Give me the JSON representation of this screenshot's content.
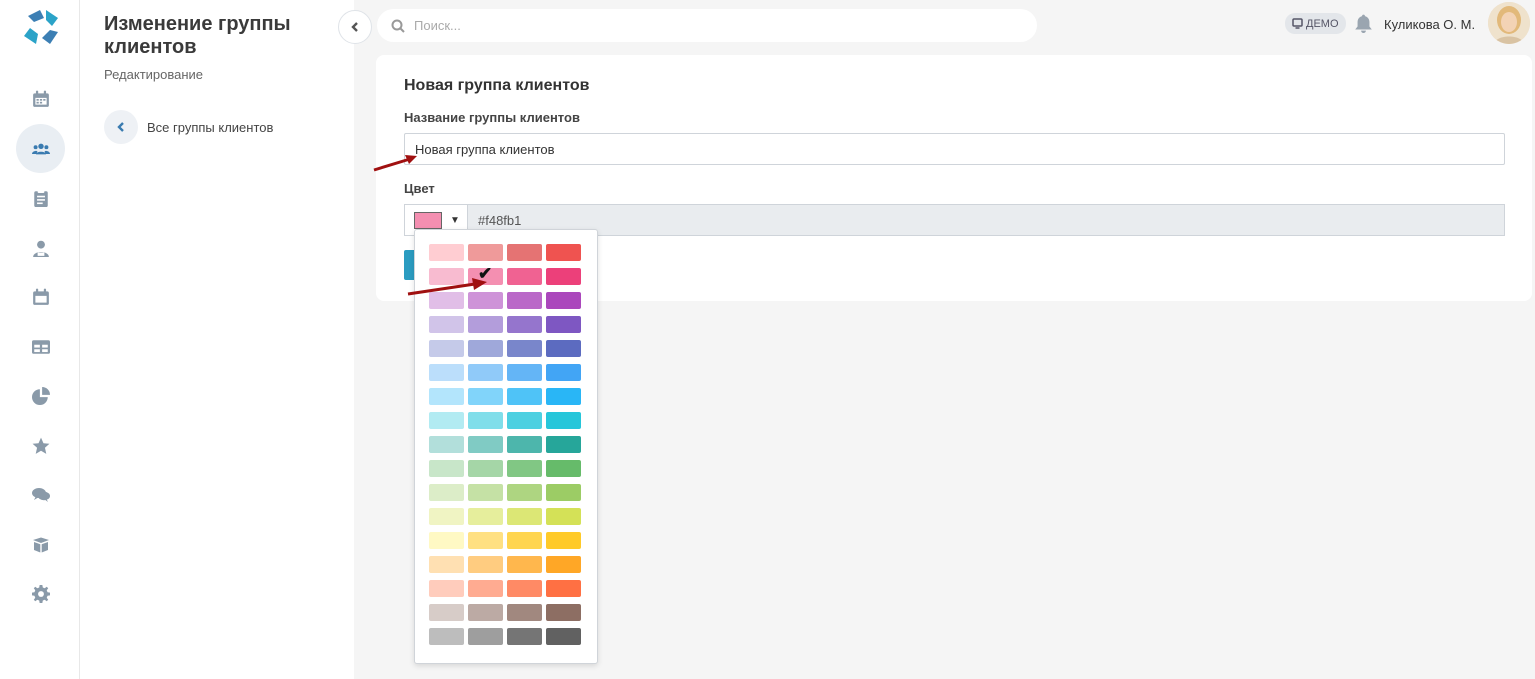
{
  "nav": {
    "items": [
      {
        "name": "calendar-icon",
        "active": false
      },
      {
        "name": "clients-icon",
        "active": true
      },
      {
        "name": "clipboard-icon",
        "active": false
      },
      {
        "name": "staff-icon",
        "active": false
      },
      {
        "name": "schedule-icon",
        "active": false
      },
      {
        "name": "table-icon",
        "active": false
      },
      {
        "name": "chart-pie-icon",
        "active": false
      },
      {
        "name": "star-icon",
        "active": false
      },
      {
        "name": "comments-icon",
        "active": false
      },
      {
        "name": "box-icon",
        "active": false
      },
      {
        "name": "gear-icon",
        "active": false
      }
    ]
  },
  "panel": {
    "title": "Изменение группы клиентов",
    "subtitle": "Редактирование",
    "back_label": "Все группы клиентов"
  },
  "topbar": {
    "search_placeholder": "Поиск...",
    "demo_label": "ДЕМО",
    "user_name": "Куликова О. М."
  },
  "form": {
    "card_title": "Новая группа клиентов",
    "name_label": "Название группы клиентов",
    "name_value": "Новая группа клиентов",
    "color_label": "Цвет",
    "color_value": "#f48fb1",
    "caret": "▼"
  },
  "palette": {
    "selected": "#f48fb1",
    "check_symbol": "✔",
    "rows": [
      [
        "#ffcdd2",
        "#ef9a9a",
        "#e57373",
        "#ef5350"
      ],
      [
        "#f8bbd0",
        "#f48fb1",
        "#f06292",
        "#ec407a"
      ],
      [
        "#e1bee7",
        "#ce93d8",
        "#ba68c8",
        "#ab47bc"
      ],
      [
        "#d1c4e9",
        "#b39ddb",
        "#9575cd",
        "#7e57c2"
      ],
      [
        "#c5cae9",
        "#9fa8da",
        "#7986cb",
        "#5c6bc0"
      ],
      [
        "#bbdefb",
        "#90caf9",
        "#64b5f6",
        "#42a5f5"
      ],
      [
        "#b3e5fc",
        "#81d4fa",
        "#4fc3f7",
        "#29b6f6"
      ],
      [
        "#b2ebf2",
        "#80deea",
        "#4dd0e1",
        "#26c6da"
      ],
      [
        "#b2dfdb",
        "#80cbc4",
        "#4db6ac",
        "#26a69a"
      ],
      [
        "#c8e6c9",
        "#a5d6a7",
        "#81c784",
        "#66bb6a"
      ],
      [
        "#dcedc8",
        "#c5e1a5",
        "#aed581",
        "#9ccc65"
      ],
      [
        "#f0f4c3",
        "#e6ee9c",
        "#dce775",
        "#d4e157"
      ],
      [
        "#fff9c4",
        "#ffe082",
        "#ffd54f",
        "#ffca28"
      ],
      [
        "#ffe0b2",
        "#ffcc80",
        "#ffb74d",
        "#ffa726"
      ],
      [
        "#ffccbc",
        "#ffab91",
        "#ff8a65",
        "#ff7043"
      ],
      [
        "#d7ccc8",
        "#bcaaa4",
        "#a1887f",
        "#8d6e63"
      ],
      [
        "#bdbdbd",
        "#9e9e9e",
        "#757575",
        "#616161"
      ]
    ]
  },
  "colors": {
    "accent": "#3a7bb0",
    "save_button": "#2b9cc1",
    "annotation_arrow": "#a01010"
  }
}
